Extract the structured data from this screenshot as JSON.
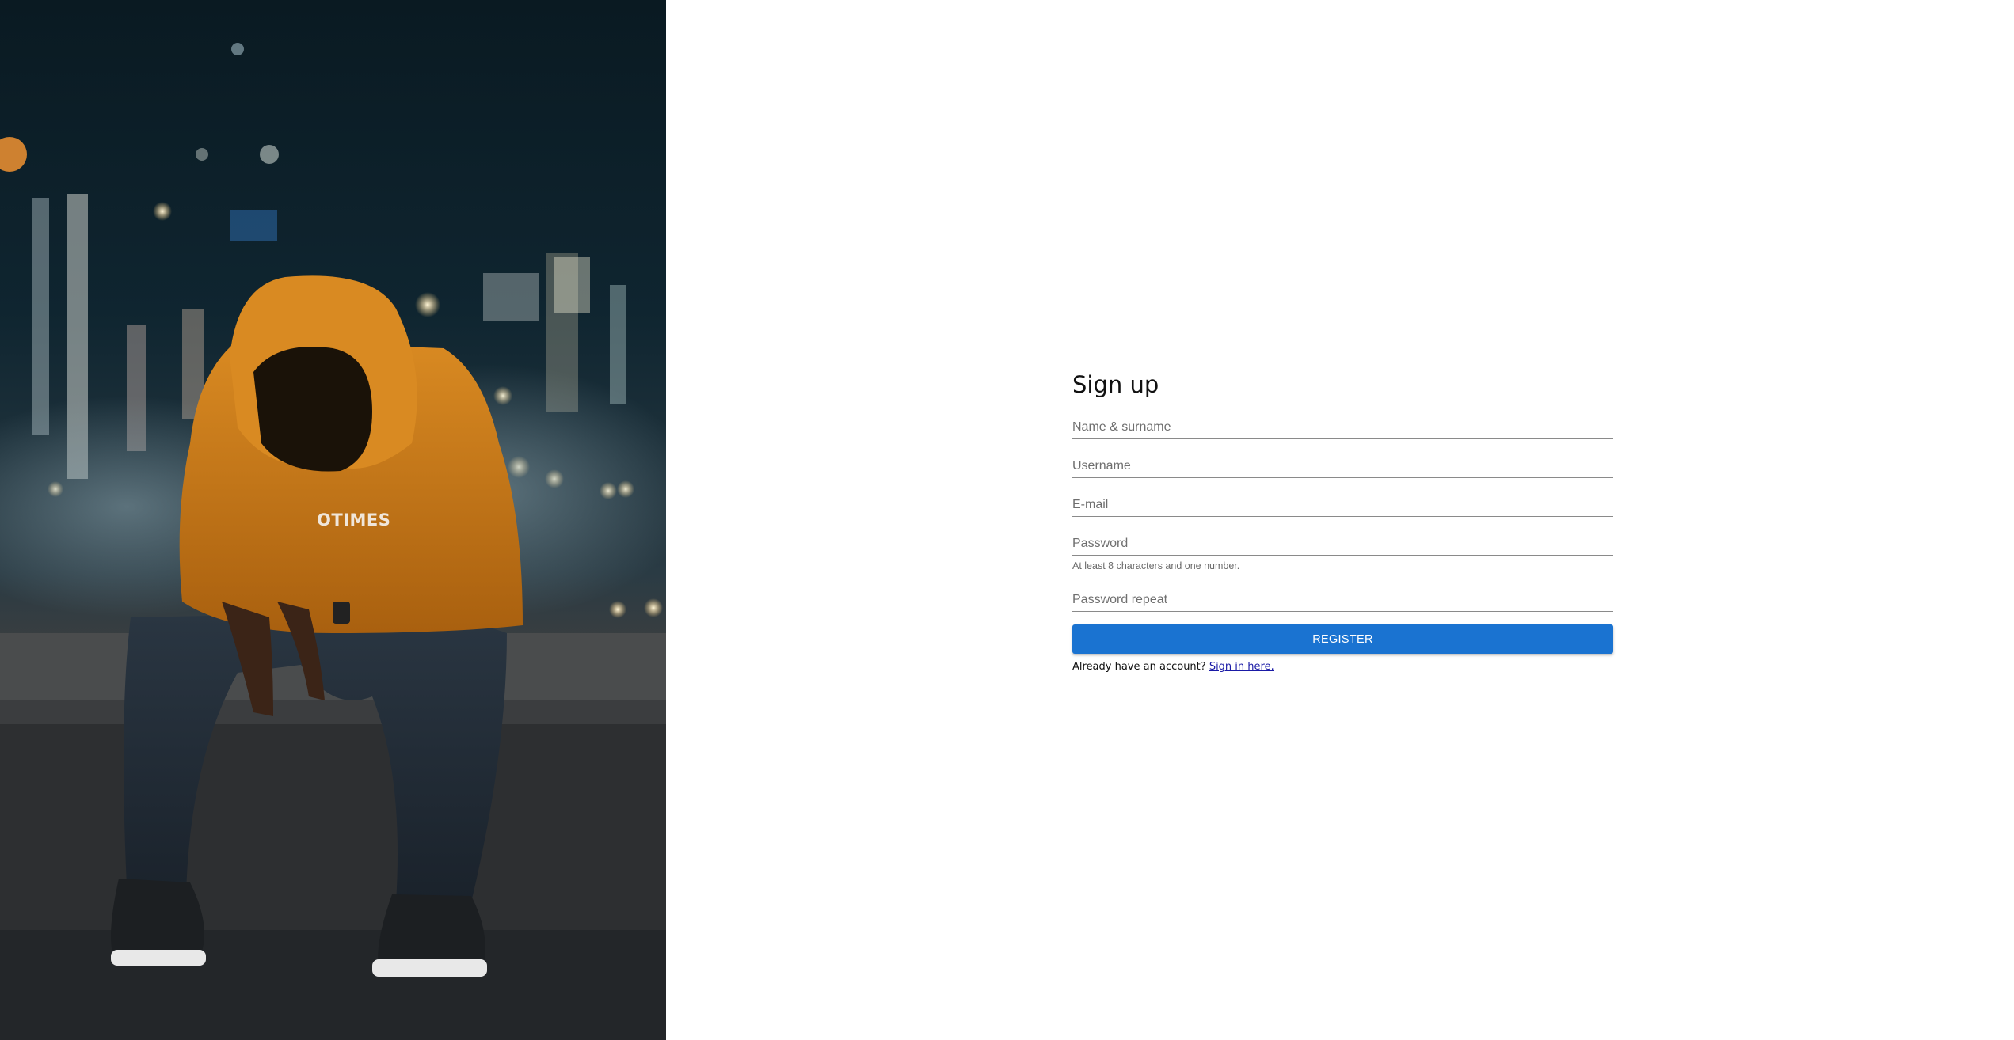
{
  "form": {
    "title": "Sign up",
    "fields": {
      "name": {
        "placeholder": "Name & surname"
      },
      "username": {
        "placeholder": "Username"
      },
      "email": {
        "placeholder": "E-mail"
      },
      "password": {
        "placeholder": "Password",
        "hint": "At least 8 characters and one number."
      },
      "password_repeat": {
        "placeholder": "Password repeat"
      }
    },
    "register_label": "REGISTER",
    "signin_prompt": "Already have an account?",
    "signin_link": "Sign in here."
  },
  "photo": {
    "hoodie_text": "OTIMES"
  },
  "colors": {
    "accent": "#1a73d1",
    "link": "#1a1aa6",
    "hoodie": "#c87a1e"
  }
}
